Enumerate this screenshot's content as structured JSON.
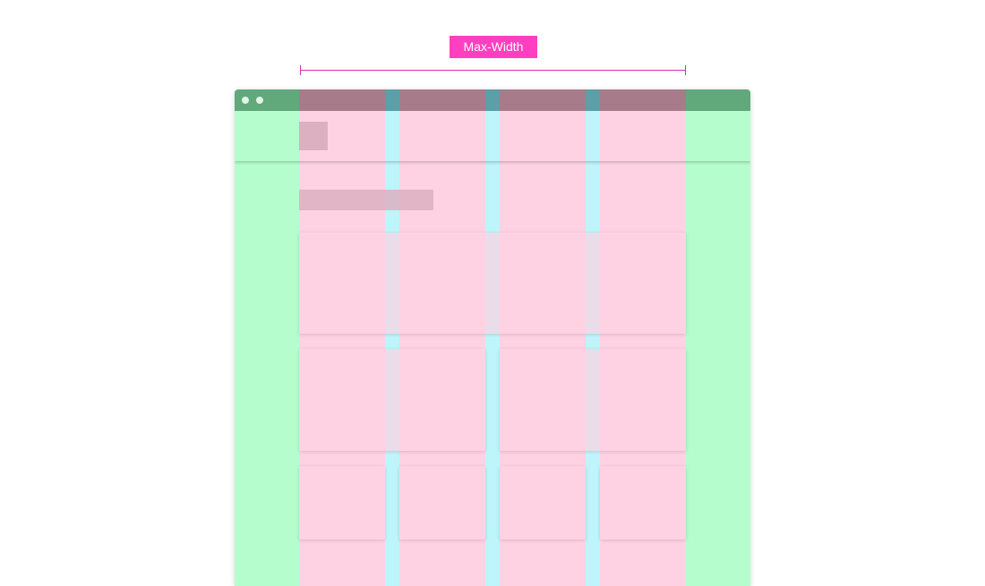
{
  "label": {
    "text": "Max-Width"
  },
  "colors": {
    "label_bg": "#ff3fbf",
    "measure_line": "#d62fb0",
    "viewport_margin": "#b5fdcc",
    "browser_bar": "#61a87a",
    "column": "#ffd2e3",
    "column_over_bar": "#a87b8a",
    "gutter": "#bdf5fb",
    "gutter_over_bar": "#5b9fa8",
    "placeholder_dark": "#dcb0c1",
    "dot": "#dff5e6"
  },
  "layout_legend": {
    "columns": 4,
    "gutters": 3
  }
}
